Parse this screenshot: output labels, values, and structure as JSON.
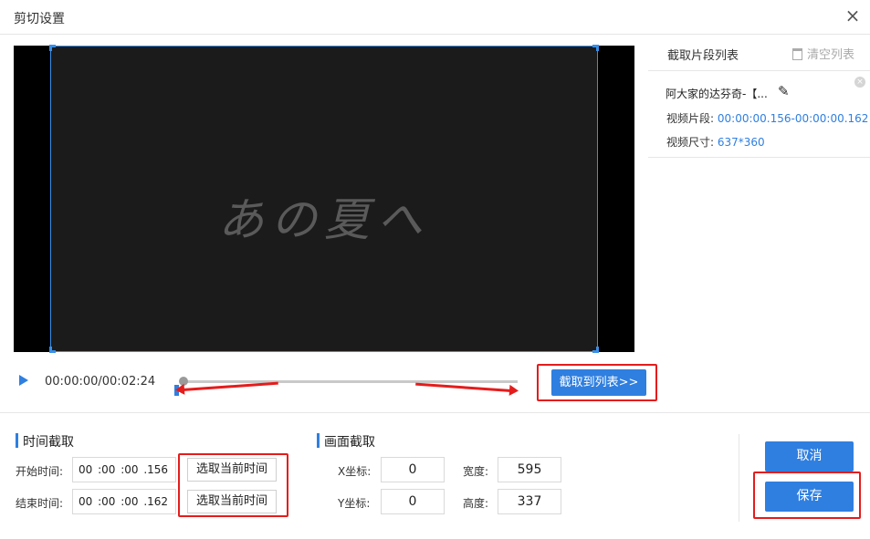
{
  "window": {
    "title": "剪切设置",
    "close_glyph": "×"
  },
  "player": {
    "video_caption": "あの夏へ",
    "timecode": "00:00:00/00:02:24",
    "capture_button": "截取到列表>>"
  },
  "clip_list": {
    "title": "截取片段列表",
    "clear_label": "清空列表",
    "items": [
      {
        "name": "阿大家的达芬奇-【...",
        "segment_label": "视频片段:",
        "segment_value": "00:00:00.156-00:00:00.162",
        "size_label": "视频尺寸:",
        "size_value": "637*360"
      }
    ]
  },
  "time_section": {
    "title": "时间截取",
    "start_label": "开始时间:",
    "start_value": "00 :00 :00 .156",
    "end_label": "结束时间:",
    "end_value": "00 :00 :00 .162",
    "pick_label": "选取当前时间"
  },
  "frame_section": {
    "title": "画面截取",
    "x_label": "X坐标:",
    "x_value": "0",
    "y_label": "Y坐标:",
    "y_value": "0",
    "width_label": "宽度:",
    "width_value": "595",
    "height_label": "高度:",
    "height_value": "337"
  },
  "actions": {
    "cancel": "取消",
    "save": "保存"
  },
  "icons": {
    "play": "play-icon",
    "trash": "trash-icon",
    "edit": "pencil-icon",
    "remove": "remove-circle-icon"
  },
  "colors": {
    "accent": "#2f7fe0",
    "annotation": "#e51c1c",
    "video_bg": "#1b1b1b"
  }
}
